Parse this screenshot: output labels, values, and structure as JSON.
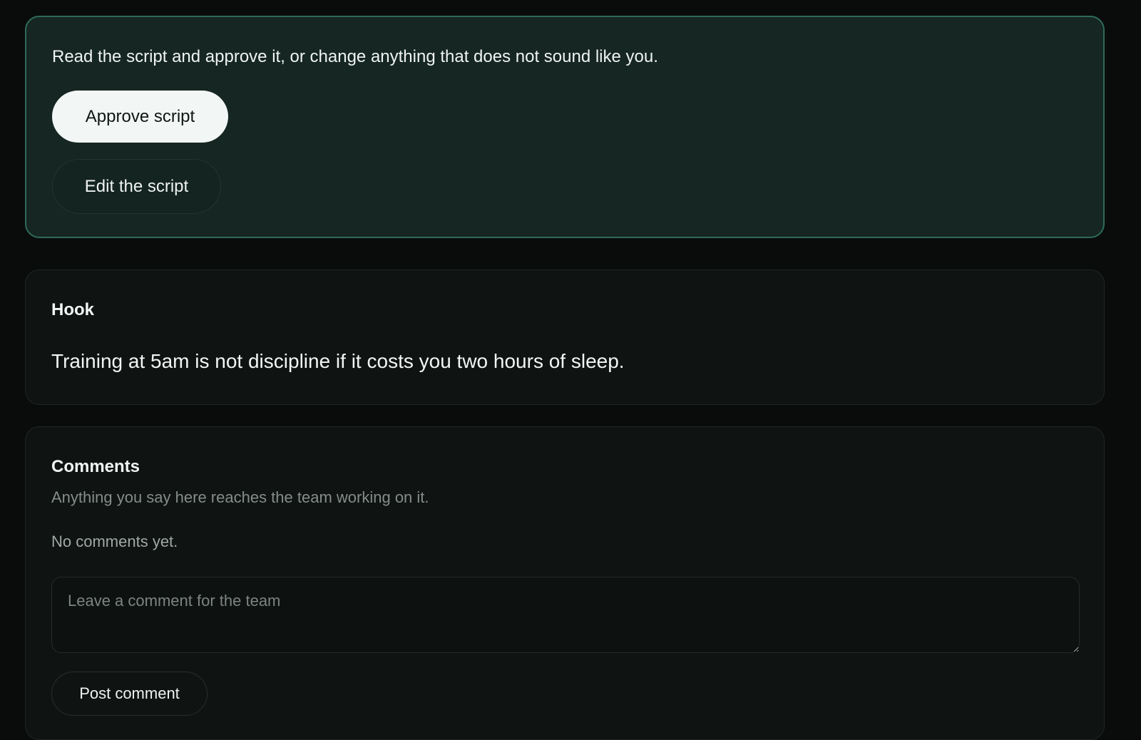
{
  "approval": {
    "prompt": "Read the script and approve it, or change anything that does not sound like you.",
    "approve_label": "Approve script",
    "edit_label": "Edit the script"
  },
  "hook": {
    "title": "Hook",
    "text": "Training at 5am is not discipline if it costs you two hours of sleep."
  },
  "comments": {
    "title": "Comments",
    "subtitle": "Anything you say here reaches the team working on it.",
    "empty_state": "No comments yet.",
    "input_placeholder": "Leave a comment for the team",
    "input_value": "",
    "post_label": "Post comment"
  },
  "colors": {
    "background": "#0a0c0c",
    "approval_card": "#162622",
    "approval_border": "#2e6b58",
    "card": "#0f1312",
    "primary_button": "#f2f6f4"
  }
}
